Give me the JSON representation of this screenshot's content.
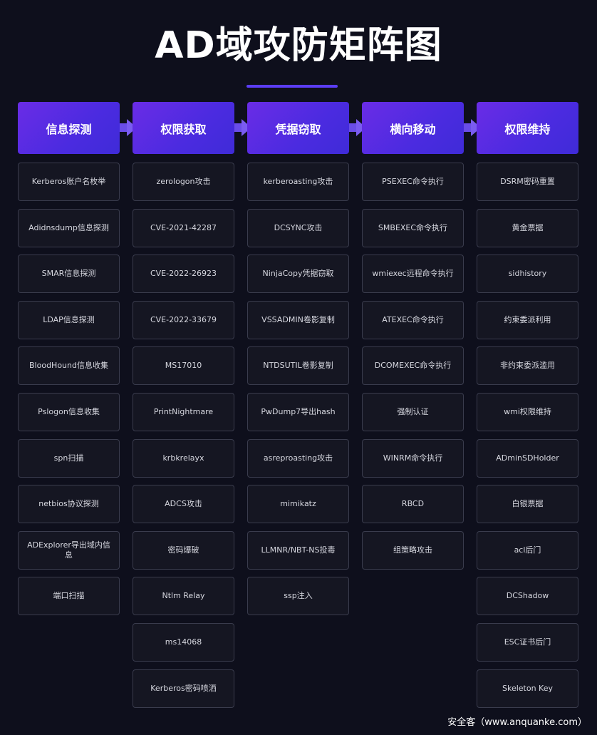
{
  "title": "AD域攻防矩阵图",
  "columns": [
    {
      "header": "信息探测",
      "items": [
        "Kerberos账户名枚举",
        "Adidnsdump信息探测",
        "SMAR信息探测",
        "LDAP信息探测",
        "BloodHound信息收集",
        "Pslogon信息收集",
        "spn扫描",
        "netbios协议探测",
        "ADExplorer导出域内信息",
        "端口扫描"
      ]
    },
    {
      "header": "权限获取",
      "items": [
        "zerologon攻击",
        "CVE-2021-42287",
        "CVE-2022-26923",
        "CVE-2022-33679",
        "MS17010",
        "PrintNightmare",
        "krbkrelayx",
        "ADCS攻击",
        "密码爆破",
        "Ntlm Relay",
        "ms14068",
        "Kerberos密码喷洒"
      ]
    },
    {
      "header": "凭据窃取",
      "items": [
        "kerberoasting攻击",
        "DCSYNC攻击",
        "NinjaCopy凭据窃取",
        "VSSADMIN卷影复制",
        "NTDSUTIL卷影复制",
        "PwDump7导出hash",
        "asreproasting攻击",
        "mimikatz",
        "LLMNR/NBT-NS投毒",
        "ssp注入"
      ]
    },
    {
      "header": "横向移动",
      "items": [
        "PSEXEC命令执行",
        "SMBEXEC命令执行",
        "wmiexec远程命令执行",
        "ATEXEC命令执行",
        "DCOMEXEC命令执行",
        "强制认证",
        "WINRM命令执行",
        "RBCD",
        "组策略攻击"
      ]
    },
    {
      "header": "权限维持",
      "items": [
        "DSRM密码重置",
        "黄金票据",
        "sidhistory",
        "约束委派利用",
        "非约束委派滥用",
        "wmi权限维持",
        "ADminSDHolder",
        "白银票据",
        "acl后门",
        "DCShadow",
        "ESC证书后门",
        "Skeleton Key"
      ]
    }
  ],
  "watermark": "安全客（www.anquanke.com）"
}
